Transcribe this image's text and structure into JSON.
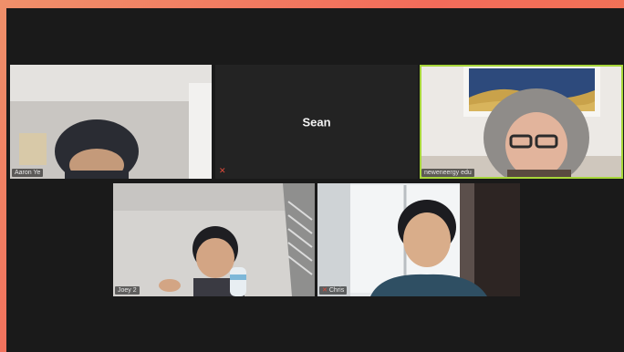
{
  "participants": [
    {
      "name": "Aaron Ye"
    },
    {
      "name": "Sean",
      "mic_muted": true,
      "mute_glyph": "✕"
    },
    {
      "name": "neweneergy edu",
      "active_speaker": true
    },
    {
      "name": "Joey 2"
    },
    {
      "name": "Chris",
      "mic_muted": true,
      "mute_glyph": "✕"
    }
  ],
  "colors": {
    "active_border": "#a7d63a",
    "muted": "#e04a3a",
    "window_bg": "#1a1a1a"
  }
}
